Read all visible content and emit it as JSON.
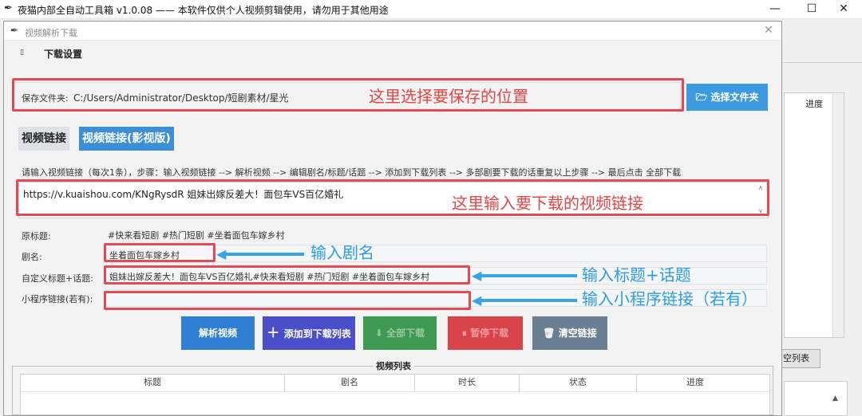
{
  "main_window": {
    "title": "夜猫内部全自动工具箱 v1.0.08 —— 本软件仅供个人视频剪辑使用，请勿用于其他用途",
    "bg_progress_header": "进度",
    "bg_clear_button": "空列表"
  },
  "dialog": {
    "title": "视频解析下载",
    "section_title": "下载设置",
    "save_folder_label": "保存文件夹:",
    "save_folder_value": "C:/Users/Administrator/Desktop/短剧素材/星光",
    "choose_folder_button": "选择文件夹",
    "tabs": [
      "视频链接",
      "视频链接(影视版)"
    ],
    "instructions": "请输入视频链接（每次1条），步骤：输入视频链接 --> 解析视频 --> 编辑剧名/标题/话题 --> 添加到下载列表 --> 多部剧要下载的话重复以上步骤 --> 最后点击 全部下载",
    "link_input_value": "https://v.kuaishou.com/KNgRysdR 姐妹出嫁反差大！面包车VS百亿婚礼",
    "original_title_label": "原标题:",
    "original_title_value": "#快来看短剧 #热门短剧 #坐着面包车嫁乡村",
    "drama_name_label": "剧名:",
    "drama_name_value": "坐着面包车嫁乡村",
    "custom_title_label": "自定义标题+话题:",
    "custom_title_value": "姐妹出嫁反差大！面包车VS百亿婚礼#快来看短剧 #热门短剧 #坐着面包车嫁乡村",
    "miniprogram_label": "小程序链接(若有):",
    "miniprogram_value": "",
    "buttons": {
      "parse": "解析视频",
      "add": "添加到下载列表",
      "download_all": "全部下载",
      "pause": "暂停下载",
      "clear": "清空链接"
    },
    "list_title": "视频列表",
    "list_headers": [
      "标题",
      "剧名",
      "时长",
      "状态",
      "进度"
    ]
  },
  "annotations": {
    "save_location": "这里选择要保存的位置",
    "link_input": "这里输入要下载的视频链接",
    "drama_name": "输入剧名",
    "title_topic": "输入标题+话题",
    "miniprogram": "输入小程序链接（若有）"
  },
  "colors": {
    "annotation_red": "#e24a55",
    "annotation_blue": "#2f9be2",
    "btn_parse": "#2f7fd3",
    "btn_add": "#4a4fc9",
    "btn_download": "#3e9a52",
    "btn_pause": "#d9434a",
    "btn_clear": "#6b7f92",
    "folder_btn": "#3b9ae0"
  }
}
